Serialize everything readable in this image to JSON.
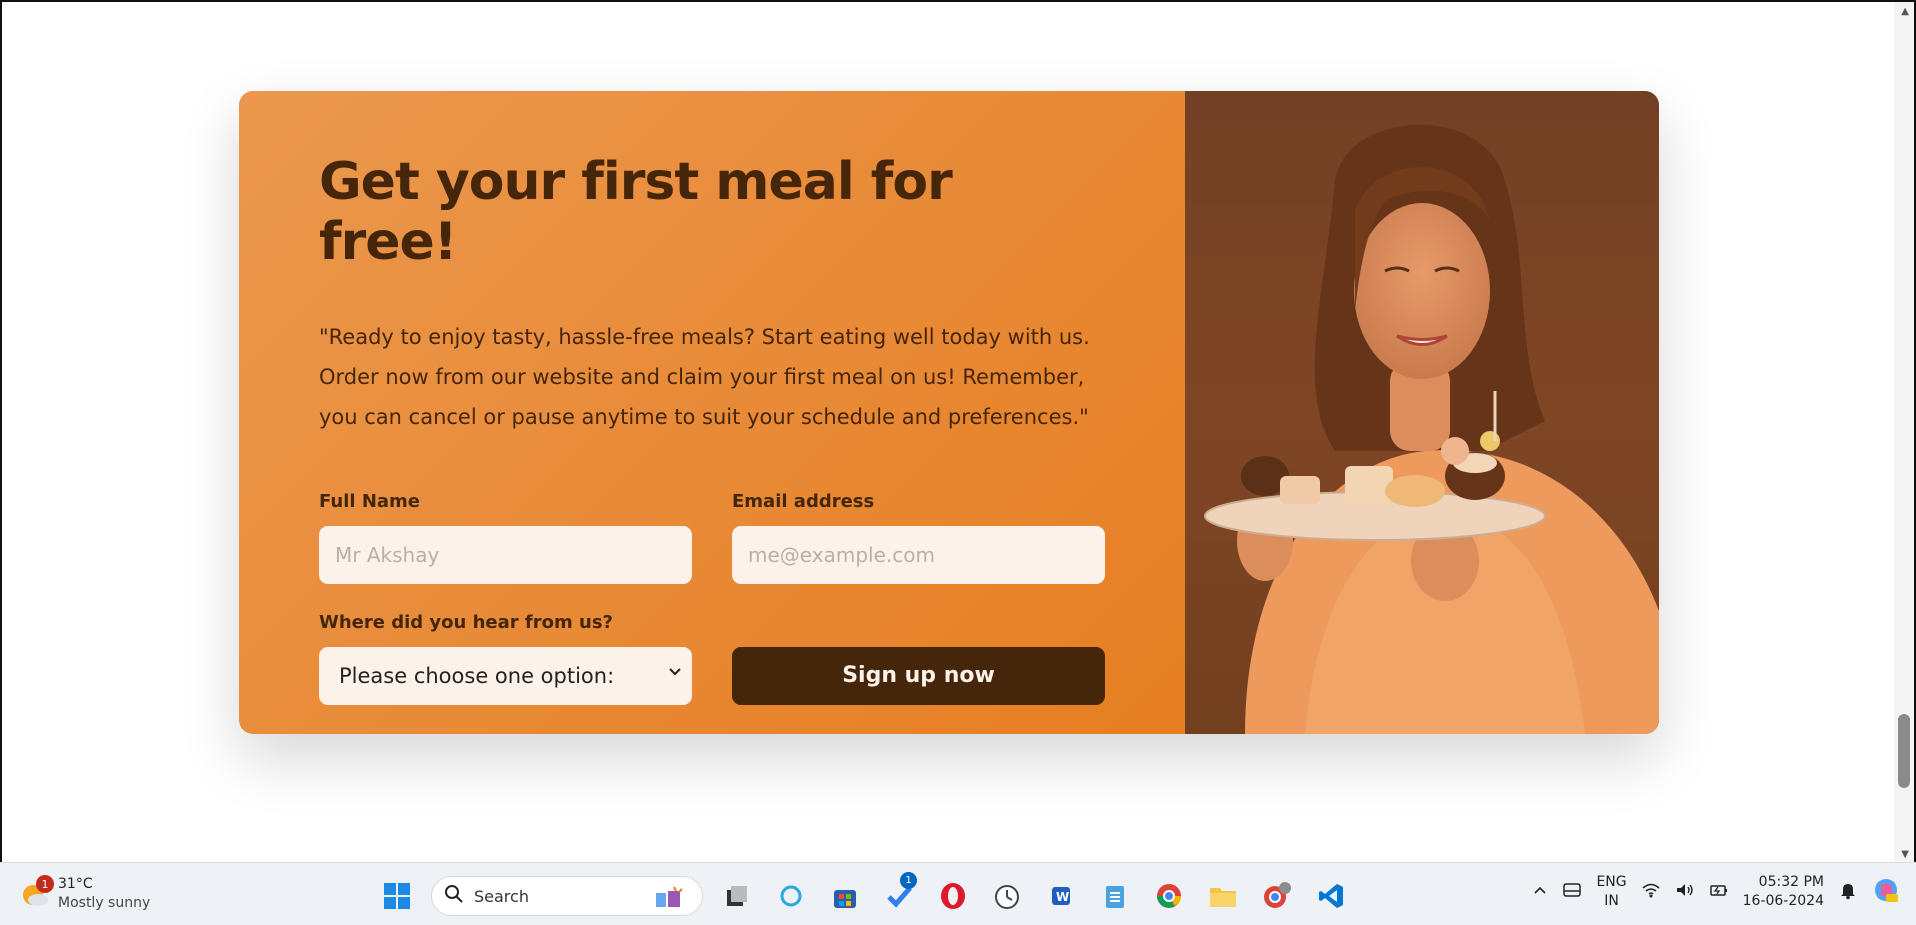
{
  "cta": {
    "title": "Get your first meal for free!",
    "description": "\"Ready to enjoy tasty, hassle-free meals? Start eating well today with us. Order now from our website and claim your first meal on us! Remember, you can cancel or pause anytime to suit your schedule and preferences.\"",
    "full_name_label": "Full Name",
    "full_name_placeholder": "Mr Akshay",
    "email_label": "Email address",
    "email_placeholder": "me@example.com",
    "source_label": "Where did you hear from us?",
    "source_selected": "Please choose one option:",
    "signup_label": "Sign up now",
    "colors": {
      "primary": "#e67e22",
      "dark": "#45260a",
      "input_bg": "#fdf2e9"
    }
  },
  "taskbar": {
    "weather": {
      "temp": "31°C",
      "condition": "Mostly sunny",
      "badge": "1"
    },
    "search_placeholder": "Search",
    "todo_badge": "1",
    "language": {
      "line1": "ENG",
      "line2": "IN"
    },
    "clock": {
      "time": "05:32 PM",
      "date": "16-06-2024"
    },
    "pinned_icons": [
      "windows-start-icon",
      "task-view-icon",
      "cortana-icon",
      "store-icon",
      "todo-icon",
      "opera-icon",
      "clock-app-icon",
      "word-icon",
      "notepad-icon",
      "chrome-icon",
      "file-explorer-icon",
      "chrome-profile-icon",
      "vscode-icon"
    ]
  }
}
